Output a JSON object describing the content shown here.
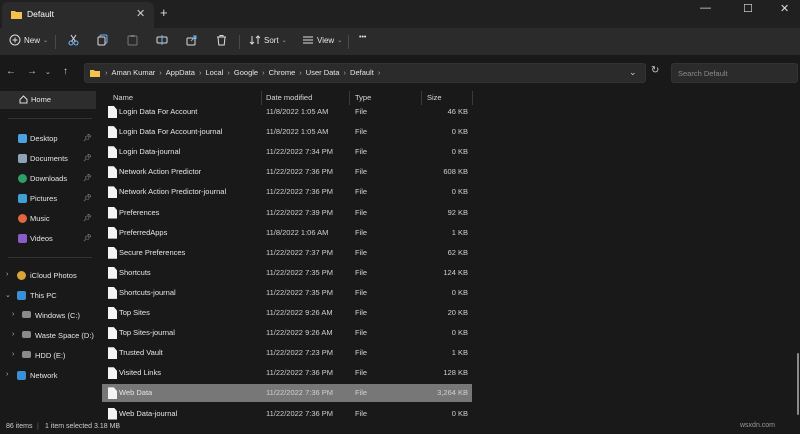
{
  "window": {
    "tab_title": "Default",
    "tab_close": "✕",
    "new_tab": "+",
    "minimize": "—",
    "maximize": "☐",
    "close": "✕"
  },
  "commands": {
    "new_label": "New",
    "sort_label": "Sort",
    "view_label": "View",
    "more_label": "•••"
  },
  "address": {
    "crumbs": [
      "Aman Kumar",
      "AppData",
      "Local",
      "Google",
      "Chrome",
      "User Data",
      "Default"
    ],
    "search_placeholder": "Search Default"
  },
  "nav": {
    "home": "Home",
    "quick": [
      "Desktop",
      "Documents",
      "Downloads",
      "Pictures",
      "Music",
      "Videos"
    ],
    "icloud": "iCloud Photos",
    "thispc": "This PC",
    "drives": [
      "Windows (C:)",
      "Waste Space (D:)",
      "HDD (E:)"
    ],
    "network": "Network"
  },
  "columns": {
    "name": "Name",
    "date": "Date modified",
    "type": "Type",
    "size": "Size"
  },
  "files": [
    {
      "name": "Login Data For Account",
      "date": "11/8/2022 1:05 AM",
      "type": "File",
      "size": "46 KB"
    },
    {
      "name": "Login Data For Account-journal",
      "date": "11/8/2022 1:05 AM",
      "type": "File",
      "size": "0 KB"
    },
    {
      "name": "Login Data-journal",
      "date": "11/22/2022 7:34 PM",
      "type": "File",
      "size": "0 KB"
    },
    {
      "name": "Network Action Predictor",
      "date": "11/22/2022 7:36 PM",
      "type": "File",
      "size": "608 KB"
    },
    {
      "name": "Network Action Predictor-journal",
      "date": "11/22/2022 7:36 PM",
      "type": "File",
      "size": "0 KB"
    },
    {
      "name": "Preferences",
      "date": "11/22/2022 7:39 PM",
      "type": "File",
      "size": "92 KB"
    },
    {
      "name": "PreferredApps",
      "date": "11/8/2022 1:06 AM",
      "type": "File",
      "size": "1 KB"
    },
    {
      "name": "Secure Preferences",
      "date": "11/22/2022 7:37 PM",
      "type": "File",
      "size": "62 KB"
    },
    {
      "name": "Shortcuts",
      "date": "11/22/2022 7:35 PM",
      "type": "File",
      "size": "124 KB"
    },
    {
      "name": "Shortcuts-journal",
      "date": "11/22/2022 7:35 PM",
      "type": "File",
      "size": "0 KB"
    },
    {
      "name": "Top Sites",
      "date": "11/22/2022 9:26 AM",
      "type": "File",
      "size": "20 KB"
    },
    {
      "name": "Top Sites-journal",
      "date": "11/22/2022 9:26 AM",
      "type": "File",
      "size": "0 KB"
    },
    {
      "name": "Trusted Vault",
      "date": "11/22/2022 7:23 PM",
      "type": "File",
      "size": "1 KB"
    },
    {
      "name": "Visited Links",
      "date": "11/22/2022 7:36 PM",
      "type": "File",
      "size": "128 KB"
    },
    {
      "name": "Web Data",
      "date": "11/22/2022 7:36 PM",
      "type": "File",
      "size": "3,264 KB",
      "selected": true
    },
    {
      "name": "Web Data-journal",
      "date": "11/22/2022 7:36 PM",
      "type": "File",
      "size": "0 KB"
    }
  ],
  "status": {
    "count": "86 items",
    "selection": "1 item selected  3.18 MB"
  },
  "watermark": "wsxdn.com",
  "colors": {
    "selected_row": "#777777",
    "background": "#191919",
    "toolbar": "#2b2b2b"
  }
}
